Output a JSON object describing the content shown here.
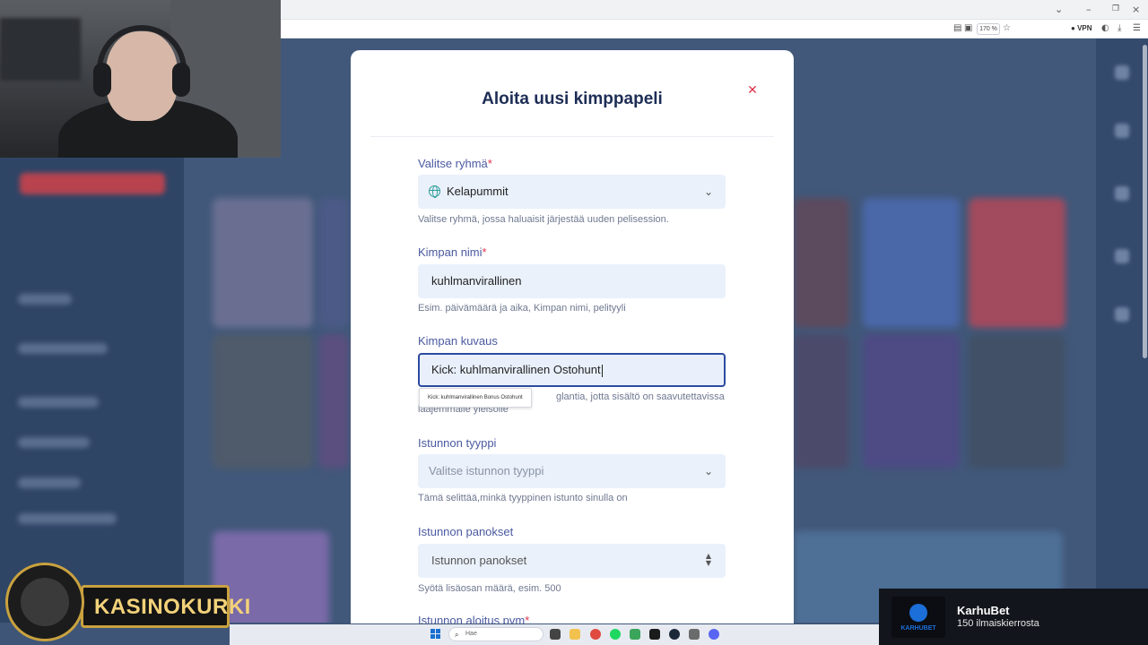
{
  "browser": {
    "zoom": "170 %",
    "vpn_label": "VPN",
    "icons": [
      "reader-icon",
      "screenshot-icon",
      "bookmark-star-icon",
      "vpn-icon",
      "account-icon",
      "download-icon",
      "menu-icon"
    ],
    "window_controls": [
      "chevron-down-icon",
      "minimize-icon",
      "restore-icon",
      "close-icon"
    ]
  },
  "modal": {
    "title": "Aloita uusi kimppapeli",
    "close_icon": "close-icon",
    "fields": {
      "group": {
        "label": "Valitse ryhmä",
        "required_mark": "*",
        "value": "Kelapummit",
        "hint": "Valitse ryhmä, jossa haluaisit järjestää uuden pelisession."
      },
      "name": {
        "label": "Kimpan nimi",
        "required_mark": "*",
        "value": "kuhlmanvirallinen",
        "hint": "Esim. päivämäärä ja aika, Kimpan nimi, pelityyli"
      },
      "description": {
        "label": "Kimpan kuvaus",
        "value": "Kick: kuhlmanvirallinen Ostohunt",
        "hint_line1": "glantia, jotta sisältö on saavutettavissa",
        "hint_line2": "laajemmalle yleisölle",
        "autocomplete": "Kick: kuhlmanvirallinen Bonus Ostohunt"
      },
      "session_type": {
        "label": "Istunnon tyyppi",
        "placeholder": "Valitse istunnon tyyppi",
        "hint": "Tämä selittää,minkä tyyppinen istunto sinulla on"
      },
      "stakes": {
        "label": "Istunnon panokset",
        "placeholder": "Istunnon panokset",
        "hint": "Syötä lisäosan määrä, esim. 500"
      },
      "start_date": {
        "label": "Istunnon aloitus pvm",
        "required_mark": "*"
      }
    }
  },
  "overlay": {
    "logo_text": "KASINOKURKI",
    "ad_brand": "KarhuBet",
    "ad_logo_text": "KARHUBET",
    "ad_offer": "150 ilmaiskierrosta"
  },
  "taskbar": {
    "search_placeholder": "Hae"
  },
  "colors": {
    "accent": "#2c4aa0",
    "label": "#4a5aa0",
    "required": "#e0334a",
    "field_bg": "#eaf1fb",
    "title": "#1d2d55",
    "logo_gold": "#c9a23f"
  }
}
